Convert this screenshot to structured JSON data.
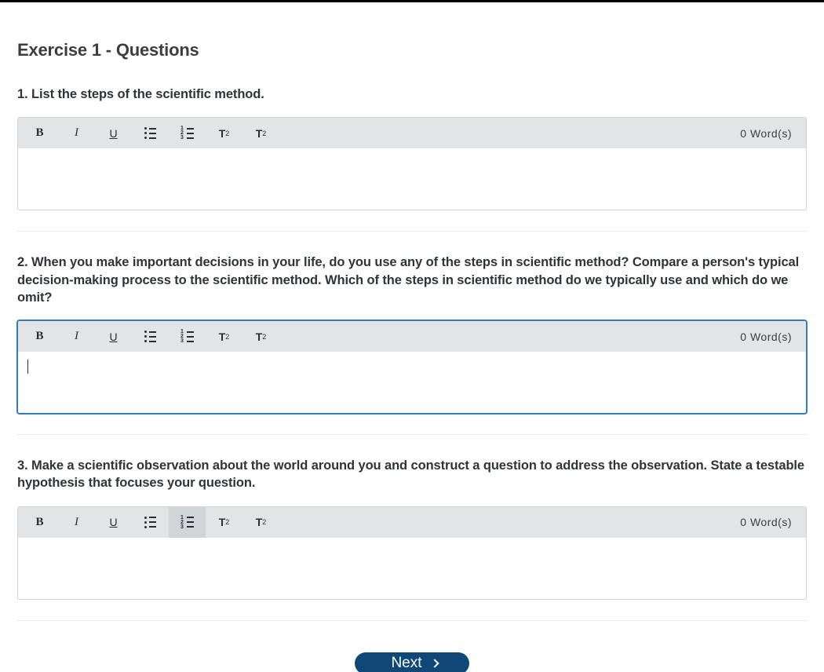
{
  "exercise_title": "Exercise 1 - Questions",
  "toolbar": {
    "bold": "B",
    "italic": "I",
    "underline": "U",
    "superscript_base": "T",
    "superscript_mark": "2",
    "subscript_base": "T",
    "subscript_mark": "2"
  },
  "word_count_suffix": " Word(s)",
  "questions": [
    {
      "prompt": "1. List the steps of the scientific method.",
      "word_count": "0",
      "focused": false,
      "ordered_active": false,
      "show_cursor": false
    },
    {
      "prompt": "2. When you make important decisions in your life, do you use any of the steps in scientific method? Compare a person's typical decision-making process to the scientific method. Which of the steps in scientific method do we typically use and which do we omit?",
      "word_count": "0",
      "focused": true,
      "ordered_active": false,
      "show_cursor": true
    },
    {
      "prompt": "3. Make a scientific observation about the world around you and construct a question to address the observation. State a testable hypothesis that focuses your question.",
      "word_count": "0",
      "focused": false,
      "ordered_active": true,
      "show_cursor": false
    }
  ],
  "next_label": "Next"
}
